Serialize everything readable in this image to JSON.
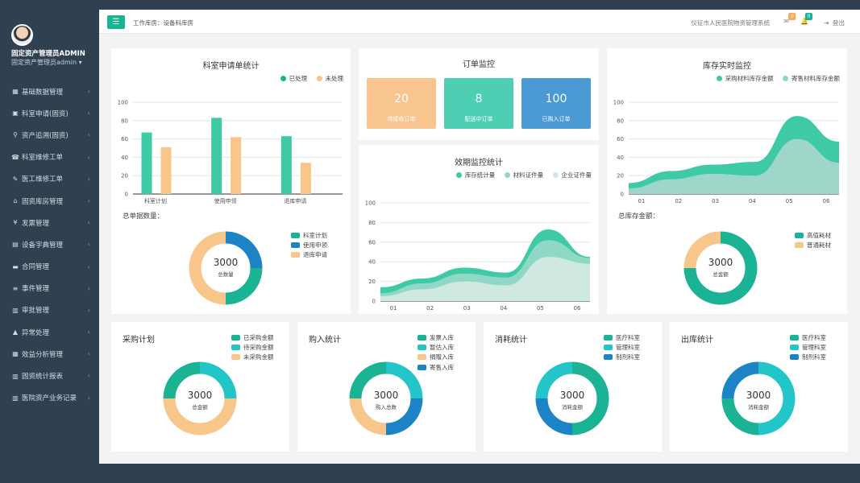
{
  "sidebar": {
    "user_name": "固定资产管理员ADMIN",
    "user_role": "固定资产管理员admin ▾",
    "items": [
      {
        "label": "基础数据管理",
        "icon": "▦"
      },
      {
        "label": "科室申请(固资)",
        "icon": "▣"
      },
      {
        "label": "资产追溯(固资)",
        "icon": "⚲"
      },
      {
        "label": "科室维修工单",
        "icon": "☎"
      },
      {
        "label": "医工维修工单",
        "icon": "✎"
      },
      {
        "label": "固资库房管理",
        "icon": "⌂"
      },
      {
        "label": "发票管理",
        "icon": "¥"
      },
      {
        "label": "设备字典管理",
        "icon": "▤"
      },
      {
        "label": "合同管理",
        "icon": "▬"
      },
      {
        "label": "事件管理",
        "icon": "≡"
      },
      {
        "label": "审批管理",
        "icon": "▥"
      },
      {
        "label": "异常处理",
        "icon": "▲"
      },
      {
        "label": "效益分析管理",
        "icon": "▦"
      },
      {
        "label": "固资统计报表",
        "icon": "▥"
      },
      {
        "label": "医院资产业务记录",
        "icon": "▥"
      }
    ]
  },
  "header": {
    "menu_icon": "☰",
    "breadcrumb": "工作库房：设备科库房",
    "system_name": "仪征市人民医院物资管理系统",
    "mail_badge": "0",
    "bell_badge": "0",
    "logout": "登出"
  },
  "colors": {
    "teal": "#1ab394",
    "teal_light": "#3fcaa6",
    "orange": "#f8c58a",
    "blue": "#1c84c6",
    "cyan": "#23c6c8",
    "order_orange": "#f8c48f",
    "order_teal": "#4ecfb3",
    "order_blue": "#4b9ad4"
  },
  "dept_request": {
    "title": "科室申请单统计",
    "legend": [
      "已处理",
      "未处理"
    ],
    "total_label": "总单据数量：",
    "donut": {
      "value": "3000",
      "label": "总数量",
      "legend": [
        "科室计划",
        "使用申领",
        "退库申请"
      ]
    }
  },
  "order_monitor": {
    "title": "订单监控",
    "boxes": [
      {
        "value": "20",
        "label": "待接收订单",
        "color": "#f8c48f"
      },
      {
        "value": "8",
        "label": "配送中订单",
        "color": "#4ecfb3"
      },
      {
        "value": "100",
        "label": "已购入订单",
        "color": "#4b9ad4"
      }
    ]
  },
  "expiry_monitor": {
    "title": "效期监控统计",
    "legend": [
      "库存统计量",
      "材料证件量",
      "企业证件量"
    ]
  },
  "inventory_monitor": {
    "title": "库存实时监控",
    "legend": [
      "采购材料库存金额",
      "寄售材料库存金额"
    ],
    "total_label": "总库存金额：",
    "donut": {
      "value": "3000",
      "label": "总金额",
      "legend": [
        "高值耗材",
        "普通耗材"
      ]
    }
  },
  "bottom_cards": [
    {
      "title": "采购计划",
      "value": "3000",
      "label": "总金额",
      "legend": [
        "已采购金额",
        "待采购金额",
        "未采购金额"
      ]
    },
    {
      "title": "购入统计",
      "value": "3000",
      "label": "购入总数",
      "legend": [
        "发票入库",
        "暂估入库",
        "捐赠入库",
        "寄售入库"
      ]
    },
    {
      "title": "消耗统计",
      "value": "3000",
      "label": "消耗金额",
      "legend": [
        "医疗科室",
        "管理科室",
        "制剂科室"
      ]
    },
    {
      "title": "出库统计",
      "value": "3000",
      "label": "消耗金额",
      "legend": [
        "医疗科室",
        "管理科室",
        "制剂科室"
      ]
    }
  ],
  "chart_data": [
    {
      "type": "bar",
      "categories": [
        "科室计划",
        "使用申领",
        "退库申请"
      ],
      "series": [
        {
          "name": "已处理",
          "values": [
            67,
            83,
            63
          ]
        },
        {
          "name": "未处理",
          "values": [
            51,
            62,
            34
          ]
        }
      ],
      "ylim": [
        0,
        100
      ],
      "yticks": [
        0,
        20,
        40,
        60,
        80,
        100
      ]
    },
    {
      "type": "area",
      "x": [
        "01",
        "02",
        "03",
        "04",
        "05",
        "06"
      ],
      "series": [
        {
          "name": "库存统计量",
          "values": [
            14,
            23,
            34,
            29,
            73,
            45
          ]
        },
        {
          "name": "材料证件量",
          "values": [
            8,
            18,
            28,
            24,
            62,
            44
          ]
        },
        {
          "name": "企业证件量",
          "values": [
            5,
            12,
            20,
            16,
            45,
            38
          ]
        }
      ],
      "ylim": [
        0,
        100
      ],
      "yticks": [
        0,
        20,
        40,
        60,
        80,
        100
      ]
    },
    {
      "type": "area",
      "x": [
        "01",
        "02",
        "03",
        "04",
        "05",
        "06"
      ],
      "series": [
        {
          "name": "采购材料库存金额",
          "values": [
            12,
            25,
            32,
            35,
            85,
            57
          ]
        },
        {
          "name": "寄售材料库存金额",
          "values": [
            6,
            16,
            22,
            20,
            60,
            34
          ]
        }
      ],
      "ylim": [
        0,
        100
      ],
      "yticks": [
        0,
        20,
        40,
        60,
        80,
        100
      ]
    },
    {
      "type": "pie",
      "categories": [
        "科室计划",
        "使用申领",
        "退库申请"
      ],
      "values": [
        25,
        25,
        50
      ]
    },
    {
      "type": "pie",
      "categories": [
        "高值耗材",
        "普通耗材"
      ],
      "values": [
        75,
        25
      ]
    },
    {
      "type": "pie",
      "categories": [
        "已采购金额",
        "待采购金额",
        "未采购金额"
      ],
      "values": [
        25,
        50,
        25
      ]
    },
    {
      "type": "pie",
      "categories": [
        "发票入库",
        "暂估入库",
        "捐赠入库",
        "寄售入库"
      ],
      "values": [
        25,
        25,
        25,
        25
      ]
    },
    {
      "type": "pie",
      "categories": [
        "医疗科室",
        "管理科室",
        "制剂科室"
      ],
      "values": [
        50,
        25,
        25
      ]
    },
    {
      "type": "pie",
      "categories": [
        "医疗科室",
        "管理科室",
        "制剂科室"
      ],
      "values": [
        50,
        25,
        25
      ]
    }
  ]
}
